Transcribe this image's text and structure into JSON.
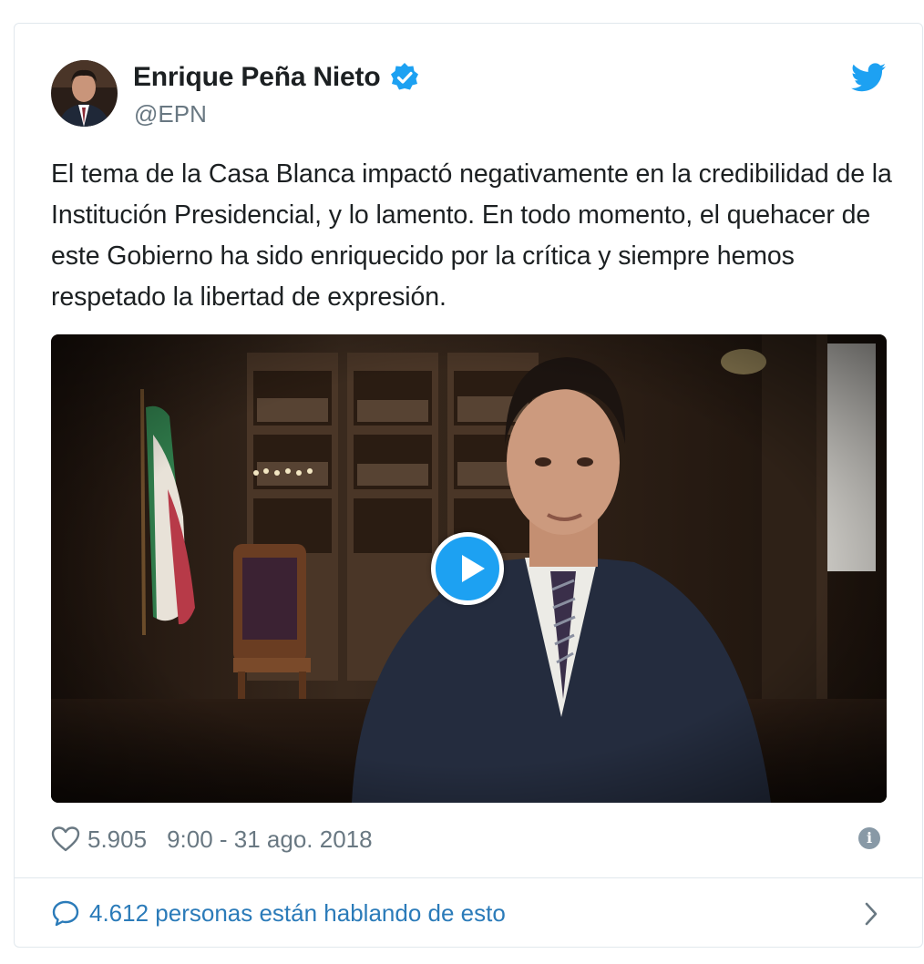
{
  "author": {
    "name": "Enrique Peña Nieto",
    "handle": "@EPN",
    "verified": true
  },
  "tweet": {
    "text": "El tema de la Casa Blanca impactó negativamente en la credibilidad de la Institución Presidencial, y lo lamento. En todo momento, el quehacer de este Gobierno ha sido enriquecido por la crítica y siempre hemos respetado la libertad de expresión."
  },
  "media": {
    "type": "video",
    "play_icon": "play-icon"
  },
  "meta": {
    "likes": "5.905",
    "timestamp": "9:00 - 31 ago. 2018"
  },
  "conversation": {
    "label": "4.612 personas están hablando de esto"
  },
  "colors": {
    "twitter_blue": "#1da1f2",
    "link_blue": "#2b7bb9",
    "muted_gray": "#697882",
    "text": "#1c2022"
  },
  "icons": [
    "twitter-bird-icon",
    "verified-icon",
    "heart-icon",
    "info-icon",
    "speech-bubble-icon",
    "chevron-right-icon",
    "play-icon"
  ]
}
